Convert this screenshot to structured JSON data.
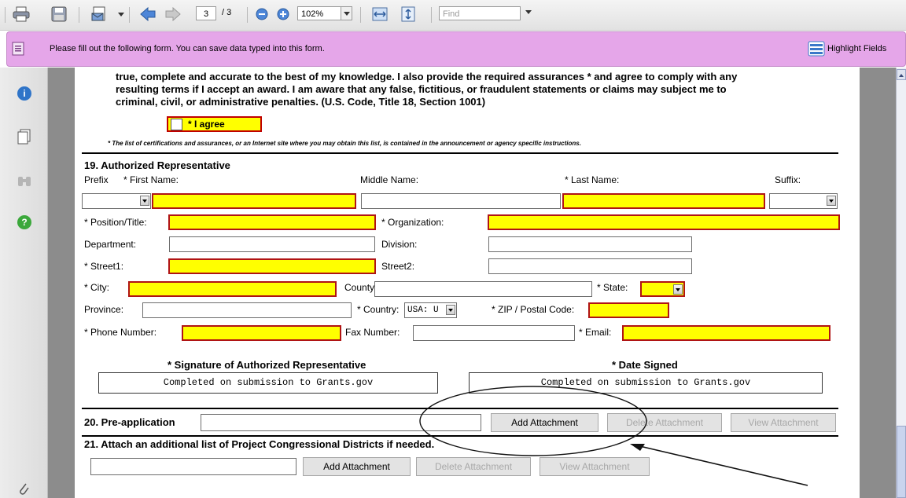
{
  "toolbar": {
    "page_current": "3",
    "page_total": "/ 3",
    "zoom": "102%",
    "find_placeholder": "Find"
  },
  "infobar": {
    "message": "Please fill out the following form. You can save data typed into this form.",
    "highlight_label": "Highlight Fields"
  },
  "form": {
    "cert_line1": "true, complete and accurate to the best of my knowledge. I also provide the required assurances * and agree to comply with any",
    "cert_line2": "resulting terms if I accept an award. I am aware that any false, fictitious, or fraudulent statements or claims may subject me to",
    "cert_line3": "criminal, civil, or administrative penalties. (U.S. Code, Title 18, Section 1001)",
    "agree_label": "* I agree",
    "cert_note": "* The list of certifications and assurances, or an Internet site where you may obtain this list, is contained in the announcement or agency specific instructions.",
    "sec19_title": "19. Authorized Representative",
    "prefix_label": "Prefix",
    "first_name_label": "* First Name:",
    "middle_name_label": "Middle Name:",
    "last_name_label": "* Last Name:",
    "suffix_label": "Suffix:",
    "position_label": "* Position/Title:",
    "organization_label": "* Organization:",
    "department_label": "Department:",
    "division_label": "Division:",
    "street1_label": "* Street1:",
    "street2_label": "Street2:",
    "city_label": "* City:",
    "county_label": "County:",
    "state_label": "* State:",
    "province_label": "Province:",
    "country_label": "* Country:",
    "country_value": "USA: U",
    "zip_label": "* ZIP / Postal Code:",
    "phone_label": "* Phone Number:",
    "fax_label": "Fax Number:",
    "email_label": "* Email:",
    "signature_label": "* Signature of Authorized Representative",
    "date_label": "* Date Signed",
    "signature_value": "Completed on submission to Grants.gov",
    "date_value": "Completed on submission to Grants.gov",
    "sec20_title": "20. Pre-application",
    "add_attachment": "Add Attachment",
    "delete_attachment": "Delete Attachment",
    "view_attachment": "View Attachment",
    "sec21_title": "21.  Attach an additional list of Project Congressional Districts if needed."
  },
  "colors": {
    "required_fill": "#ffff00",
    "required_border": "#b01414",
    "infobar_bg": "#e5a6e9"
  }
}
